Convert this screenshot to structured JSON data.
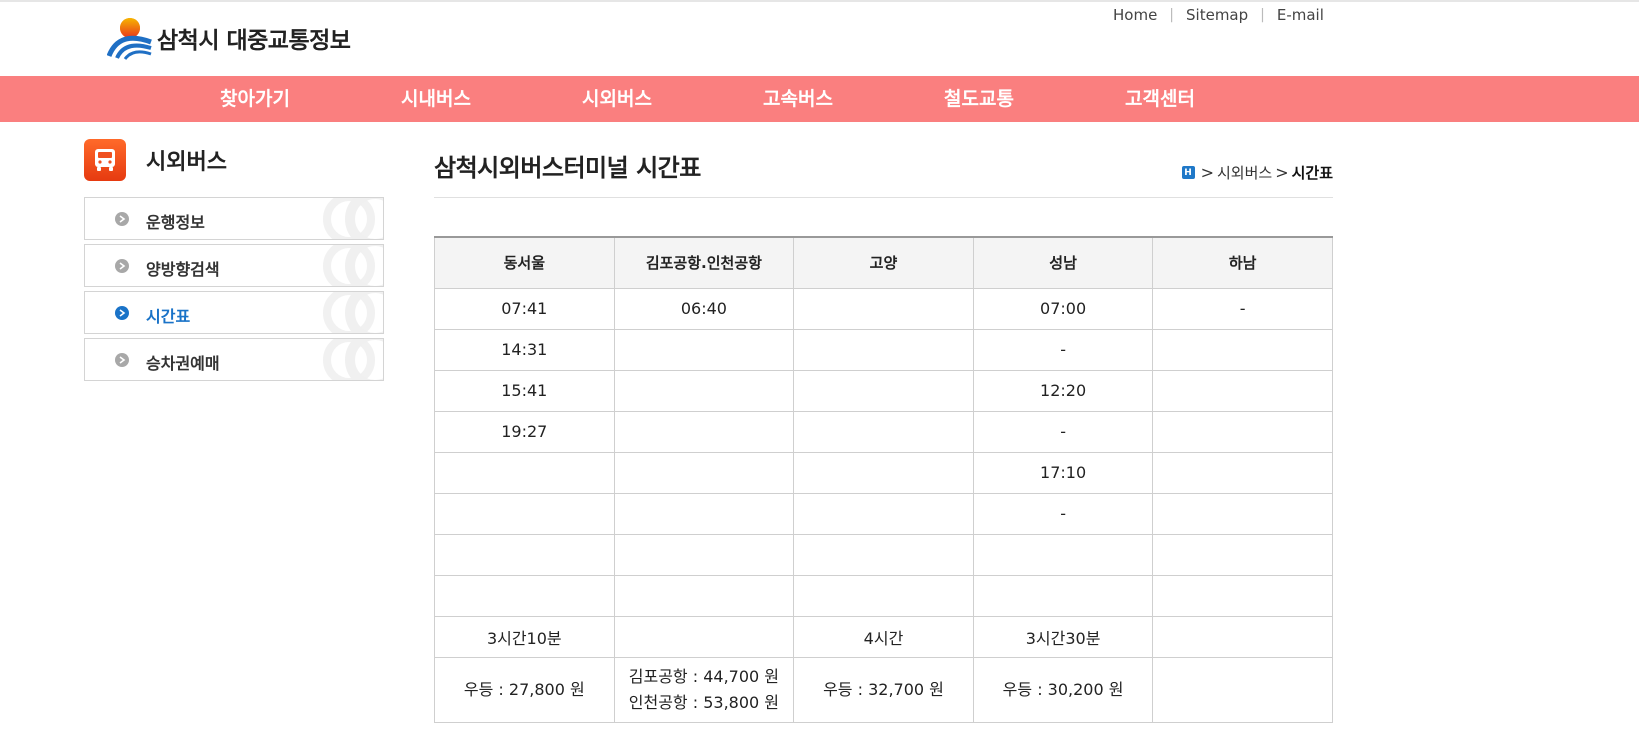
{
  "site": {
    "title": "삼척시 대중교통정보"
  },
  "util_links": [
    "Home",
    "Sitemap",
    "E-mail"
  ],
  "nav": [
    "찾아가기",
    "시내버스",
    "시외버스",
    "고속버스",
    "철도교통",
    "고객센터"
  ],
  "sidebar": {
    "title": "시외버스",
    "items": [
      {
        "label": "운행정보",
        "active": false
      },
      {
        "label": "양방향검색",
        "active": false
      },
      {
        "label": "시간표",
        "active": true
      },
      {
        "label": "승차권예매",
        "active": false
      }
    ]
  },
  "page": {
    "title": "삼척시외버스터미널 시간표",
    "breadcrumb": [
      "시외버스",
      "시간표"
    ]
  },
  "timetable": {
    "headers": [
      "동서울",
      "김포공항.인천공항",
      "고양",
      "성남",
      "하남"
    ],
    "rows": [
      [
        "07:41",
        "06:40",
        "",
        "07:00",
        "-"
      ],
      [
        "14:31",
        "",
        "",
        "-",
        ""
      ],
      [
        "15:41",
        "",
        "",
        "12:20",
        ""
      ],
      [
        "19:27",
        "",
        "",
        "-",
        ""
      ],
      [
        "",
        "",
        "",
        "17:10",
        ""
      ],
      [
        "",
        "",
        "",
        "-",
        ""
      ],
      [
        "",
        "",
        "",
        "",
        ""
      ],
      [
        "",
        "",
        "",
        "",
        ""
      ]
    ],
    "durations": [
      "3시간10분",
      "",
      "4시간",
      "3시간30분",
      ""
    ],
    "fares": [
      [
        "우등 : 27,800 원"
      ],
      [
        "김포공항 : 44,700 원",
        "인천공항 : 53,800 원"
      ],
      [
        "우등 : 32,700 원"
      ],
      [
        "우등 : 30,200 원"
      ],
      []
    ]
  },
  "colors": {
    "nav_bg": "#fa7f7f",
    "accent": "#1a73c8",
    "bus_icon": "#f05020"
  }
}
